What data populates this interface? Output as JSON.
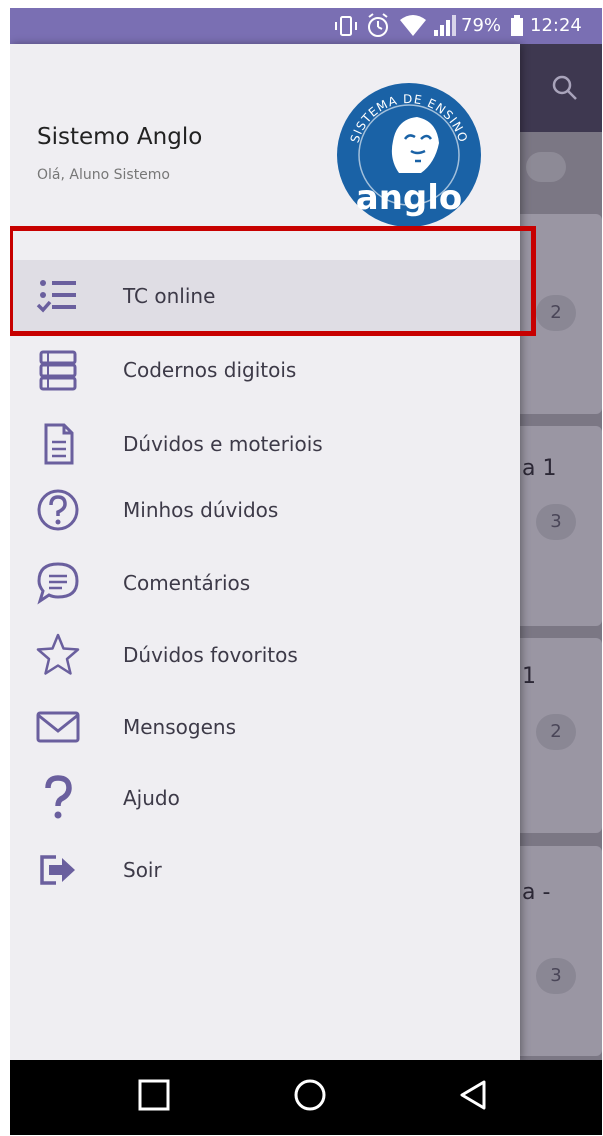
{
  "status_bar": {
    "battery": "79%",
    "time": "12:24"
  },
  "drawer": {
    "title": "Sistemo Anglo",
    "subtitle": "Olá, Aluno Sistemo",
    "logo_ring_text": "SISTEMA DE ENSINO",
    "logo_text": "anglo",
    "items": [
      {
        "label": "TC online",
        "icon": "checklist-icon",
        "active": true
      },
      {
        "label": "Codernos digitois",
        "icon": "books-icon"
      },
      {
        "label": "Dúvidos e moteriois",
        "icon": "document-icon"
      },
      {
        "label": "Minhos dúvidos",
        "icon": "question-circle-icon"
      },
      {
        "label": "Comentários",
        "icon": "chat-bubble-icon"
      },
      {
        "label": "Dúvidos fovoritos",
        "icon": "star-icon"
      },
      {
        "label": "Mensogens",
        "icon": "envelope-icon"
      },
      {
        "label": "Ajudo",
        "icon": "help-icon"
      },
      {
        "label": "Soir",
        "icon": "logout-icon"
      }
    ]
  },
  "background": {
    "badges": [
      "2",
      "3",
      "2",
      "3"
    ],
    "texts": [
      "a 1",
      "1",
      "a -"
    ]
  },
  "colors": {
    "status_bar": "#7a6fb3",
    "drawer_bg": "#efeef2",
    "icon": "#6a5f9e",
    "highlight": "#c70000",
    "logo_blue": "#1a62a6"
  }
}
